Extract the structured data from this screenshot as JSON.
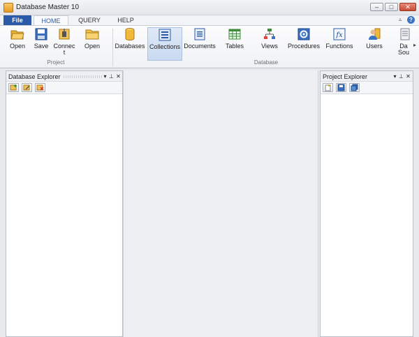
{
  "window": {
    "title": "Database Master 10"
  },
  "tabs": {
    "file": "File",
    "home": "HOME",
    "query": "QUERY",
    "help": "HELP"
  },
  "ribbon": {
    "project_group": "Project",
    "database_group": "Database",
    "buttons": {
      "open": "Open",
      "save": "Save",
      "connect_line1": "Connec",
      "connect_line2": "t",
      "open2": "Open",
      "databases": "Databases",
      "collections": "Collections",
      "documents": "Documents",
      "tables": "Tables",
      "views": "Views",
      "procedures": "Procedures",
      "functions": "Functions",
      "users": "Users",
      "datasource_line1": "Da",
      "datasource_line2": "Sou"
    }
  },
  "panels": {
    "database_explorer": {
      "title": "Database Explorer"
    },
    "project_explorer": {
      "title": "Project Explorer"
    }
  },
  "colors": {
    "accent": "#2b5aa6",
    "selected": "#c9daf1"
  }
}
